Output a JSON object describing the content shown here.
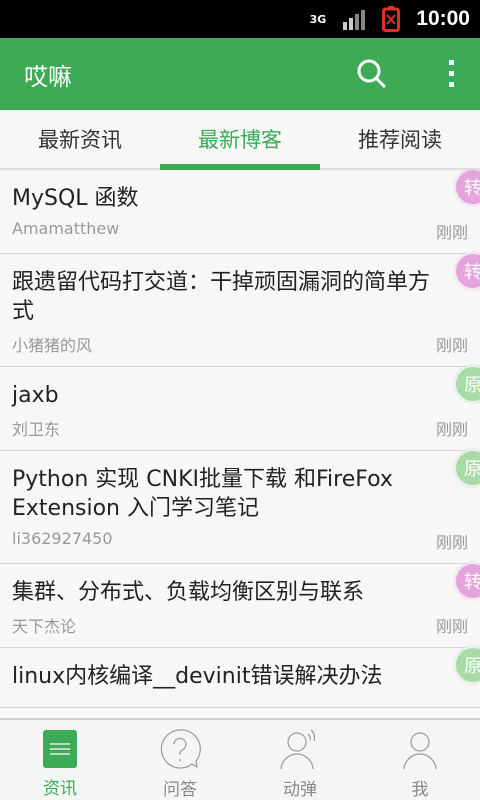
{
  "status_bar": {
    "network": "3G",
    "time": "10:00"
  },
  "toolbar": {
    "title": "哎嘛",
    "icons": [
      "search-icon",
      "overflow-menu-icon"
    ]
  },
  "tabs": [
    {
      "label": "最新资讯"
    },
    {
      "label": "最新博客",
      "active": true
    },
    {
      "label": "推荐阅读"
    }
  ],
  "items": [
    {
      "title": "MySQL 函数",
      "author": "Amamatthew",
      "time": "刚刚",
      "badge": "转",
      "badge_color": "#e6a4dc"
    },
    {
      "title": "跟遗留代码打交道：干掉顽固漏洞的简单方式",
      "author": "小猪猪的风",
      "time": "刚刚",
      "badge": "转",
      "badge_color": "#e6a4dc"
    },
    {
      "title": "jaxb",
      "author": "刘卫东",
      "time": "刚刚",
      "badge": "原",
      "badge_color": "#a8dba8"
    },
    {
      "title": "Python 实现 CNKI批量下载 和FireFox Extension 入门学习笔记",
      "author": "li362927450",
      "time": "刚刚",
      "badge": "原",
      "badge_color": "#a8dba8"
    },
    {
      "title": "集群、分布式、负载均衡区别与联系",
      "author": "天下杰论",
      "time": "刚刚",
      "badge": "转",
      "badge_color": "#e6a4dc"
    },
    {
      "title": "linux内核编译__devinit错误解决办法",
      "author": "",
      "time": "",
      "badge": "原",
      "badge_color": "#a8dba8"
    }
  ],
  "bottom_nav": [
    {
      "label": "资讯",
      "active": true
    },
    {
      "label": "问答"
    },
    {
      "label": "动弹"
    },
    {
      "label": "我"
    }
  ],
  "colors": {
    "accent": "#3daa55"
  }
}
